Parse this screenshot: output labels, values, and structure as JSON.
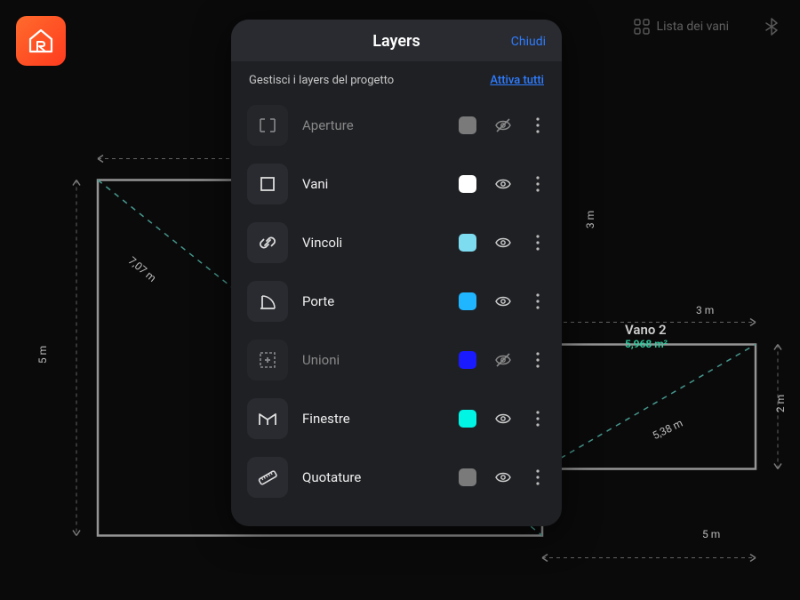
{
  "app": {
    "toolbar": {
      "room_list_label": "Lista dei vani"
    }
  },
  "modal": {
    "title": "Layers",
    "close_label": "Chiudi",
    "subtitle": "Gestisci i layers del progetto",
    "activate_all_label": "Attiva tutti"
  },
  "layers": [
    {
      "name": "Aperture",
      "icon": "aperture-icon",
      "color": "#7a7a7a",
      "visible": false
    },
    {
      "name": "Vani",
      "icon": "room-icon",
      "color": "#ffffff",
      "visible": true
    },
    {
      "name": "Vincoli",
      "icon": "link-icon",
      "color": "#7edcf0",
      "visible": true
    },
    {
      "name": "Porte",
      "icon": "door-icon",
      "color": "#1fb6ff",
      "visible": true
    },
    {
      "name": "Unioni",
      "icon": "union-icon",
      "color": "#1a1aff",
      "visible": false
    },
    {
      "name": "Finestre",
      "icon": "window-icon",
      "color": "#00f5e5",
      "visible": true
    },
    {
      "name": "Quotature",
      "icon": "measure-icon",
      "color": "#7a7a7a",
      "visible": true
    }
  ],
  "floorplan": {
    "room2_name": "Vano 2",
    "room2_area": "5,968 m²",
    "diag1": "7,07 m",
    "diag2": "5,38 m",
    "dim_5m_a": "5 m",
    "dim_5m_b": "5 m",
    "dim_3m_a": "3 m",
    "dim_3m_b": "3 m",
    "dim_2m": "2 m"
  }
}
